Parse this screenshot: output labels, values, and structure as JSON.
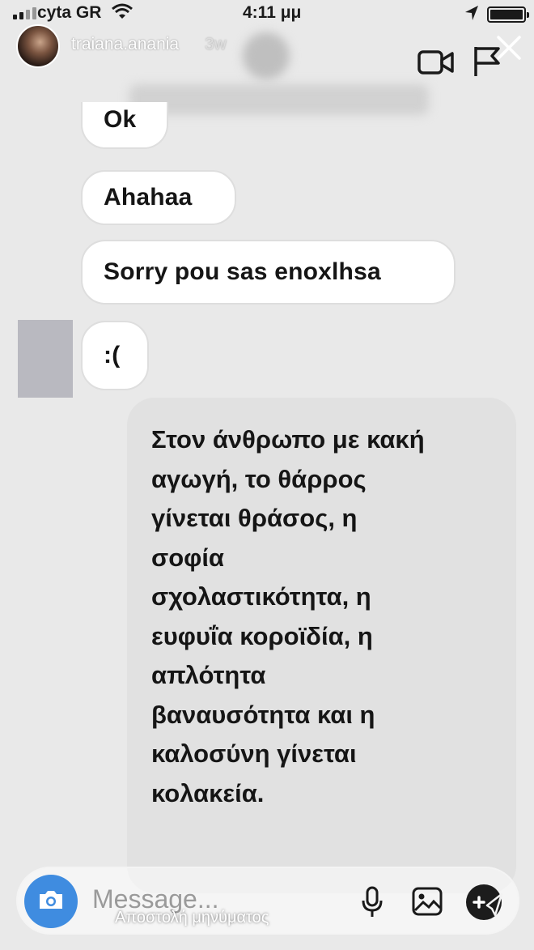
{
  "status_bar": {
    "carrier": "cyta GR",
    "time": "4:11 μμ"
  },
  "header": {
    "username": "traiana.anania",
    "time_ago": "3w"
  },
  "messages": [
    {
      "text": "Ok",
      "direction": "incoming"
    },
    {
      "text": "Ahahaa",
      "direction": "incoming"
    },
    {
      "text": "Sorry pou sas enoxlhsa",
      "direction": "incoming"
    },
    {
      "text": ":(",
      "direction": "incoming"
    },
    {
      "direction": "outgoing",
      "lines": [
        "Στον άνθρωπο με κακή",
        "αγωγή, το θάρρος",
        "γίνεται θράσος, η",
        "σοφία",
        "σχολαστικότητα, η",
        "ευφυΐα κοροϊδία, η",
        "απλότητα",
        "βαναυσότητα και η",
        "καλοσύνη γίνεται",
        "κολακεία."
      ]
    }
  ],
  "composer": {
    "placeholder": "Message...",
    "caption": "Αποστολή μηνύματος"
  },
  "colors": {
    "camera_button": "#3f8ce0",
    "outgoing_bubble": "#e1e1e1",
    "incoming_bubble": "#ffffff"
  },
  "icons": [
    "signal-icon",
    "wifi-icon",
    "location-icon",
    "battery-icon",
    "video-call-icon",
    "flag-icon",
    "close-icon",
    "camera-icon",
    "microphone-icon",
    "gallery-icon",
    "send-icon"
  ]
}
